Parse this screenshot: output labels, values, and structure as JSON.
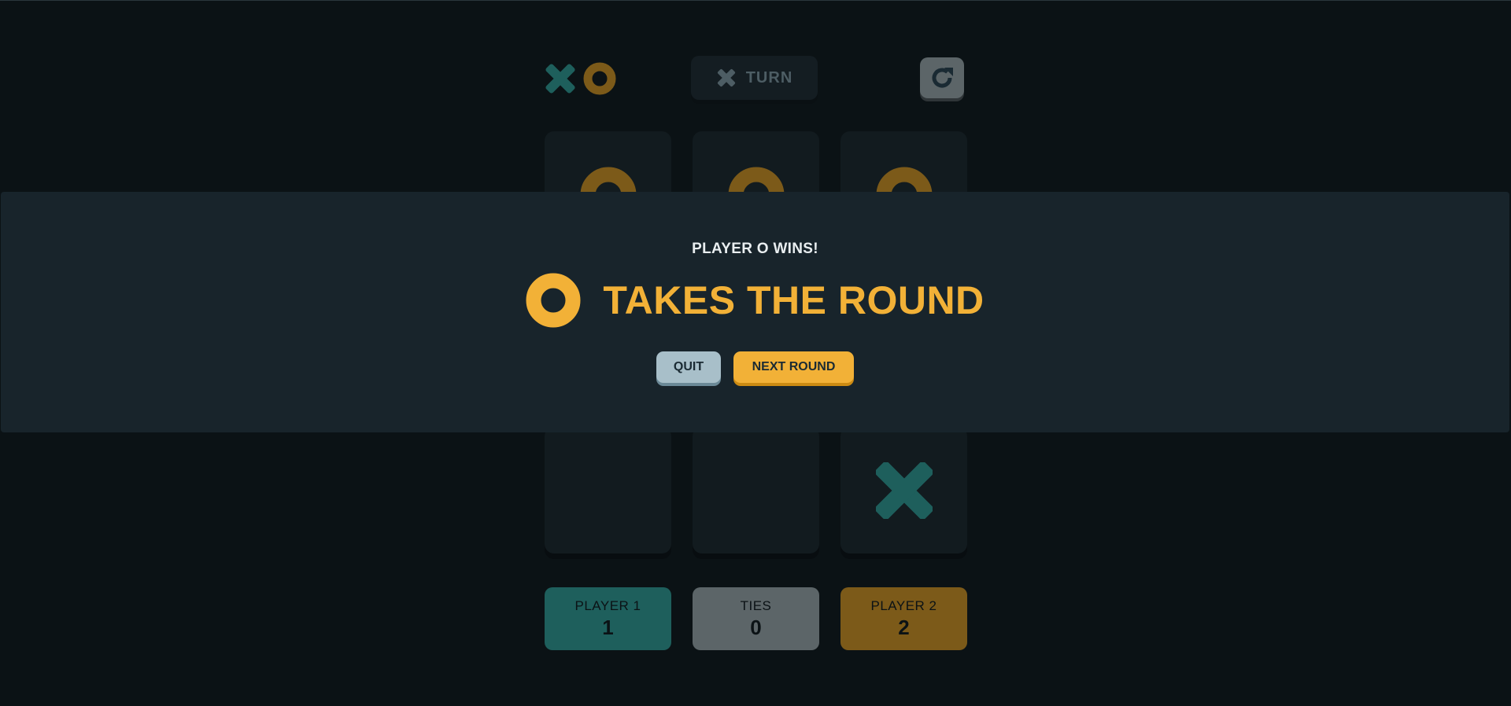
{
  "header": {
    "logo_x_icon": "x-mark",
    "logo_o_icon": "o-mark",
    "turn": {
      "player_icon": "x-mark",
      "label": "TURN"
    },
    "restart_icon": "restart-icon"
  },
  "board": {
    "cells": [
      "O",
      "O",
      "O",
      "",
      "",
      "",
      "",
      "",
      "X"
    ]
  },
  "scores": {
    "player1": {
      "label": "PLAYER 1",
      "value": "1"
    },
    "ties": {
      "label": "TIES",
      "value": "0"
    },
    "player2": {
      "label": "PLAYER 2",
      "value": "2"
    }
  },
  "modal": {
    "result": "PLAYER O WINS!",
    "winner_icon": "o-mark",
    "title": "TAKES THE ROUND",
    "quit_label": "QUIT",
    "next_label": "NEXT ROUND"
  },
  "colors": {
    "x": "#1e5f5c",
    "o": "#7c5a19",
    "o_bright": "#f2b137",
    "background": "#0b1215",
    "panel": "#18242b"
  }
}
